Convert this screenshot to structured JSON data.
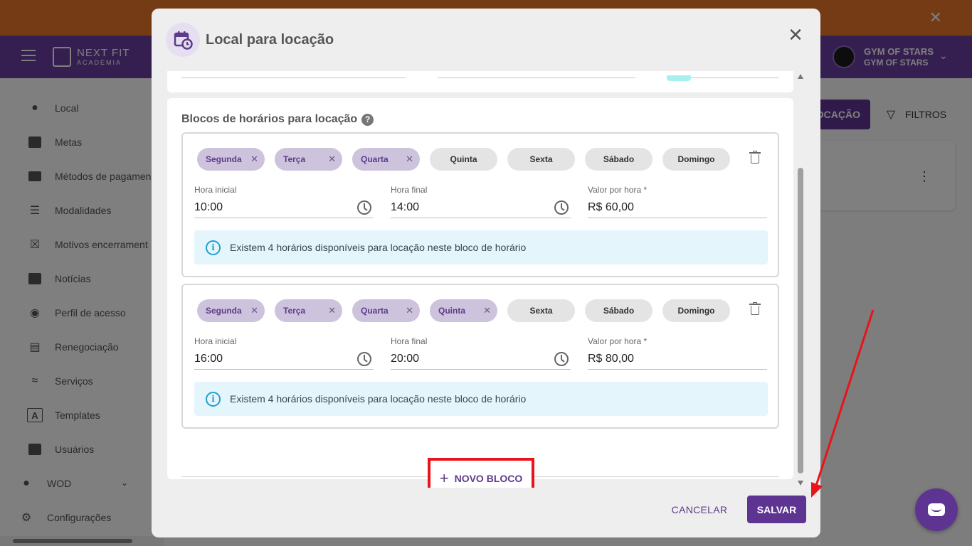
{
  "app": {
    "brand": "NEXT FIT",
    "brand_sub": "ACADEMIA",
    "gym_name": "GYM OF STARS",
    "gym_sub": "GYM OF STARS",
    "announce_close": "✕"
  },
  "sidebar": {
    "items": [
      {
        "label": "Local",
        "icon": "location-pin-icon"
      },
      {
        "label": "Metas",
        "icon": "chart-bar-icon"
      },
      {
        "label": "Métodos de pagamen",
        "icon": "credit-card-icon"
      },
      {
        "label": "Modalidades",
        "icon": "list-icon"
      },
      {
        "label": "Motivos encerrament",
        "icon": "close-box-icon"
      },
      {
        "label": "Notícias",
        "icon": "message-icon"
      },
      {
        "label": "Perfil de acesso",
        "icon": "eye-icon"
      },
      {
        "label": "Renegociação",
        "icon": "money-chat-icon"
      },
      {
        "label": "Serviços",
        "icon": "handshake-icon"
      },
      {
        "label": "Templates",
        "icon": "letter-a-icon"
      },
      {
        "label": "Usuários",
        "icon": "user-badge-icon"
      },
      {
        "label": "WOD",
        "icon": "kettlebell-icon"
      },
      {
        "label": "Configurações",
        "icon": "gear-icon"
      }
    ]
  },
  "page": {
    "locacao_button": "OCAÇÃO",
    "filters_button": "FILTROS"
  },
  "modal": {
    "title": "Local para locação",
    "section_title": "Blocos de horários para locação",
    "blocks": [
      {
        "days": [
          {
            "label": "Segunda",
            "selected": true
          },
          {
            "label": "Terça",
            "selected": true
          },
          {
            "label": "Quarta",
            "selected": true
          },
          {
            "label": "Quinta",
            "selected": false
          },
          {
            "label": "Sexta",
            "selected": false
          },
          {
            "label": "Sábado",
            "selected": false
          },
          {
            "label": "Domingo",
            "selected": false
          }
        ],
        "start_label": "Hora inicial",
        "start_value": "10:00",
        "end_label": "Hora final",
        "end_value": "14:00",
        "price_label": "Valor por hora *",
        "price_value": "R$ 60,00",
        "info": "Existem 4 horários disponíveis para locação neste bloco de horário"
      },
      {
        "days": [
          {
            "label": "Segunda",
            "selected": true
          },
          {
            "label": "Terça",
            "selected": true
          },
          {
            "label": "Quarta",
            "selected": true
          },
          {
            "label": "Quinta",
            "selected": true
          },
          {
            "label": "Sexta",
            "selected": false
          },
          {
            "label": "Sábado",
            "selected": false
          },
          {
            "label": "Domingo",
            "selected": false
          }
        ],
        "start_label": "Hora inicial",
        "start_value": "16:00",
        "end_label": "Hora final",
        "end_value": "20:00",
        "price_label": "Valor por hora *",
        "price_value": "R$ 80,00",
        "info": "Existem 4 horários disponíveis para locação neste bloco de horário"
      }
    ],
    "new_block_button": "NOVO BLOCO",
    "cancel_button": "CANCELAR",
    "save_button": "SALVAR"
  },
  "colors": {
    "brand_purple": "#5e3492",
    "header_purple": "#6b3fa0",
    "announce_orange": "#e8762b",
    "highlight_red": "#e8141a",
    "info_bg": "#e5f5fc"
  }
}
